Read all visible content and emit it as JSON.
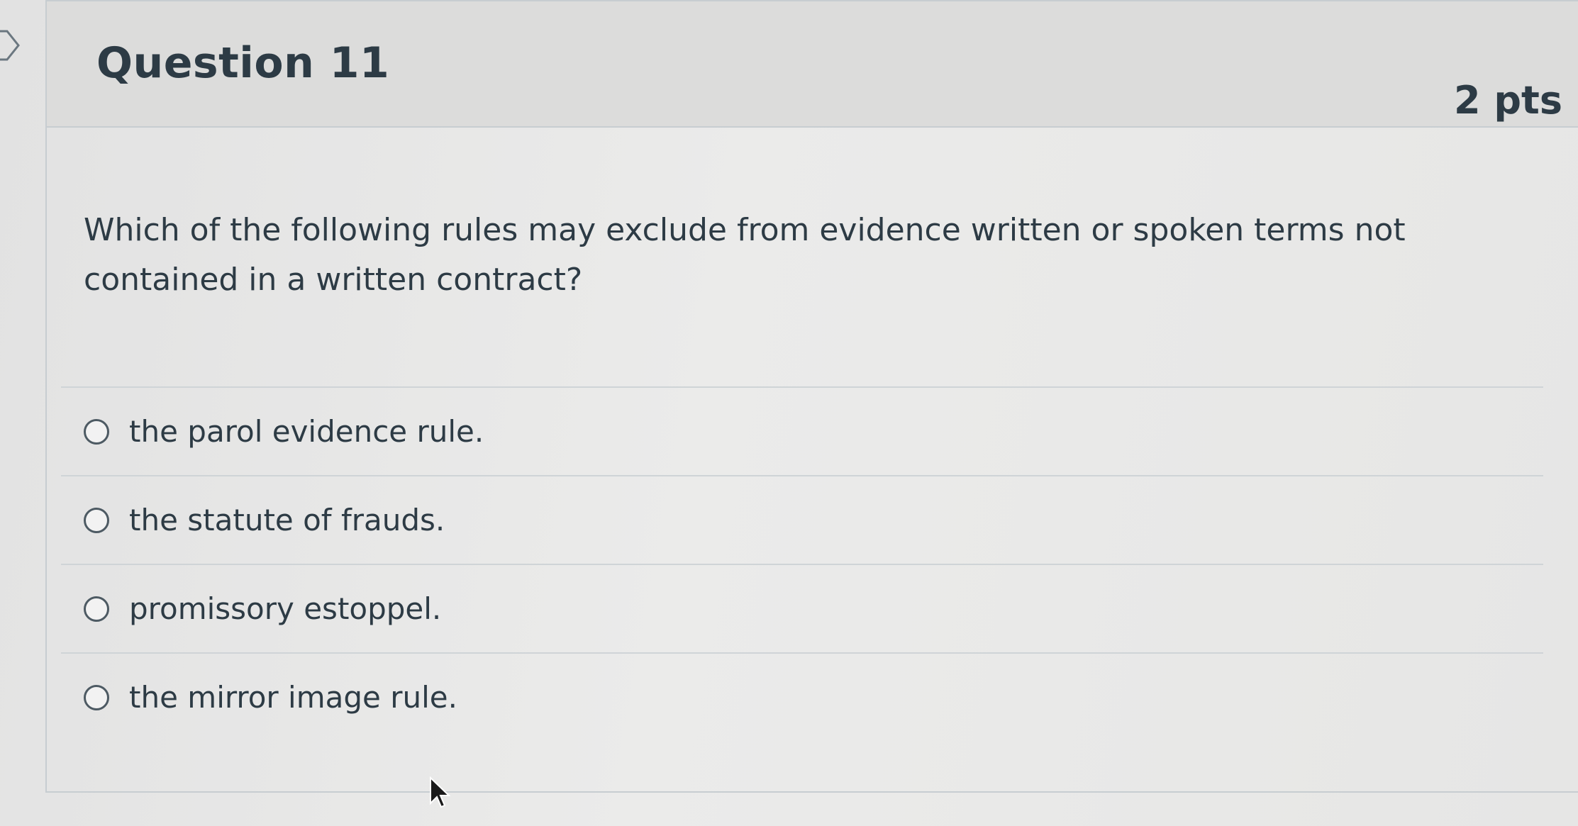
{
  "question": {
    "title": "Question 11",
    "points": "2 pts",
    "text": "Which of the following rules may exclude from evidence written or spoken terms not contained in a written contract?",
    "options": [
      {
        "label": "the parol evidence rule.",
        "selected": false
      },
      {
        "label": "the statute of frauds.",
        "selected": false
      },
      {
        "label": "promissory estoppel.",
        "selected": false
      },
      {
        "label": "the mirror image rule.",
        "selected": false
      }
    ]
  },
  "icons": {
    "flag": "flag-icon",
    "cursor": "mouse-cursor-icon",
    "radio": "radio-unselected-icon"
  },
  "colors": {
    "text": "#2d3b45",
    "header_bg": "#dcdcdb",
    "border": "#c7cdd1"
  }
}
